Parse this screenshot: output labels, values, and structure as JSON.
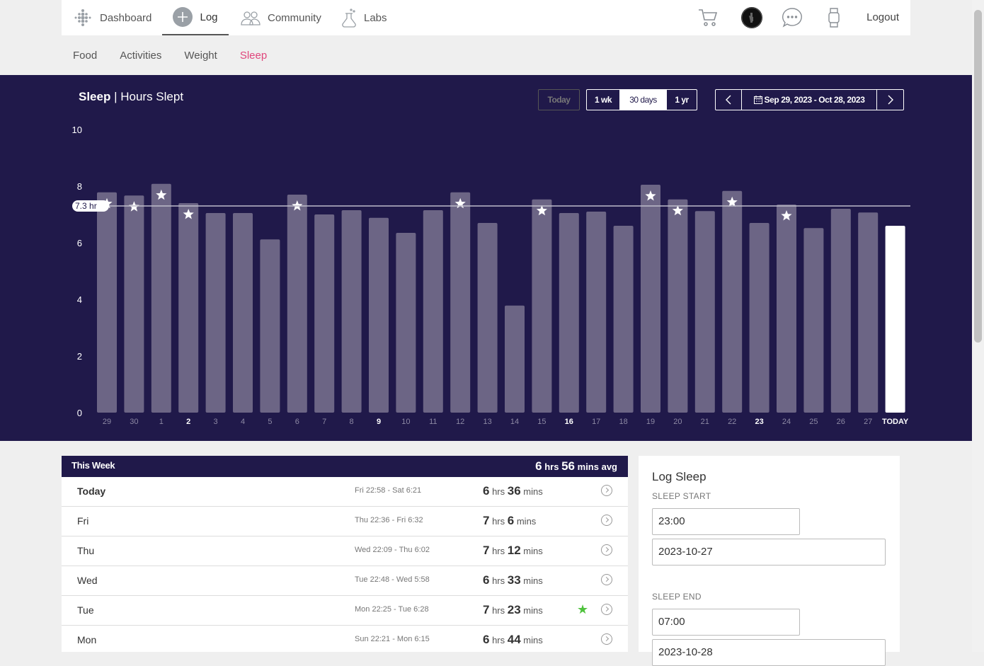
{
  "topnav": {
    "items": [
      {
        "label": "Dashboard",
        "icon": "dots-logo-icon"
      },
      {
        "label": "Log",
        "icon": "plus-circle-icon"
      },
      {
        "label": "Community",
        "icon": "people-icon"
      },
      {
        "label": "Labs",
        "icon": "flask-icon"
      }
    ],
    "logout_label": "Logout"
  },
  "subnav": {
    "items": [
      "Food",
      "Activities",
      "Weight",
      "Sleep"
    ],
    "active": "Sleep"
  },
  "chart_header": {
    "title_bold": "Sleep",
    "title_rest": " | Hours Slept",
    "today_label": "Today",
    "range_buttons": [
      "1 wk",
      "30 days",
      "1 yr"
    ],
    "selected_range": "30 days",
    "date_range": "Sep 29, 2023 - Oct 28, 2023"
  },
  "chart_data": {
    "type": "bar",
    "title": "Sleep | Hours Slept",
    "categories": [
      "29",
      "30",
      "1",
      "2",
      "3",
      "4",
      "5",
      "6",
      "7",
      "8",
      "9",
      "10",
      "11",
      "12",
      "13",
      "14",
      "15",
      "16",
      "17",
      "18",
      "19",
      "20",
      "21",
      "22",
      "23",
      "24",
      "25",
      "26",
      "27",
      "TODAY"
    ],
    "values": [
      7.78,
      7.67,
      8.08,
      7.4,
      7.05,
      7.05,
      6.12,
      7.7,
      7.0,
      7.15,
      6.88,
      6.35,
      7.15,
      7.78,
      6.7,
      3.78,
      7.53,
      7.05,
      7.1,
      6.6,
      8.05,
      7.53,
      7.12,
      7.83,
      6.7,
      7.35,
      6.52,
      7.2,
      7.07,
      6.6
    ],
    "starred": [
      "29",
      "30",
      "1",
      "2",
      "6",
      "12",
      "15",
      "19",
      "20",
      "22",
      "24"
    ],
    "bold_ticks": [
      "2",
      "9",
      "16",
      "23",
      "TODAY"
    ],
    "average_line": 7.3,
    "average_label": "7.3 hr",
    "ylim": [
      0,
      10
    ],
    "yticks": [
      0,
      2,
      4,
      6,
      8,
      10
    ],
    "grid": false,
    "colors": {
      "bar": "#6c6585",
      "today_bar": "#ffffff",
      "background": "#20194a",
      "avg_line": "#bdbbc9"
    }
  },
  "this_week": {
    "title": "This Week",
    "avg": {
      "hrs": "6",
      "hrs_unit": "hrs",
      "mins": "56",
      "mins_unit": "mins avg"
    },
    "rows": [
      {
        "day": "Today",
        "range": "Fri 22:58 - Sat 6:21",
        "hrs": "6",
        "mins": "36",
        "star": false
      },
      {
        "day": "Fri",
        "range": "Thu 22:36 - Fri 6:32",
        "hrs": "7",
        "mins": "6",
        "star": false
      },
      {
        "day": "Thu",
        "range": "Wed 22:09 - Thu 6:02",
        "hrs": "7",
        "mins": "12",
        "star": false
      },
      {
        "day": "Wed",
        "range": "Tue 22:48 - Wed 5:58",
        "hrs": "6",
        "mins": "33",
        "star": false
      },
      {
        "day": "Tue",
        "range": "Mon 22:25 - Tue 6:28",
        "hrs": "7",
        "mins": "23",
        "star": true
      },
      {
        "day": "Mon",
        "range": "Sun 22:21 - Mon 6:15",
        "hrs": "6",
        "mins": "44",
        "star": false
      }
    ],
    "hrs_unit": "hrs",
    "mins_unit": "mins"
  },
  "log_sleep": {
    "title": "Log Sleep",
    "start_label": "SLEEP START",
    "start_time": "23:00",
    "start_date": "2023-10-27",
    "end_label": "SLEEP END",
    "end_time": "07:00",
    "end_date": "2023-10-28"
  },
  "colors": {
    "accent": "#e0467c",
    "navy": "#20194a",
    "star_green": "#4fc23d"
  }
}
